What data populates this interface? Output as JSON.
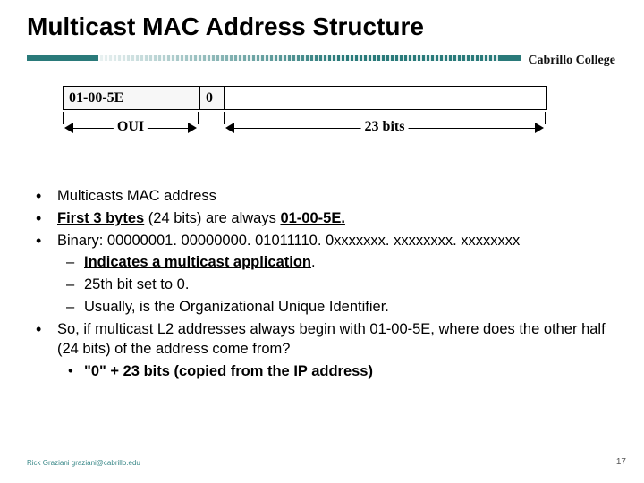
{
  "title": "Multicast MAC Address Structure",
  "brand": "Cabrillo College",
  "diagram": {
    "oui_cell": "01-00-5E",
    "zero_cell": "0",
    "oui_label": "OUI",
    "bits_label": "23 bits"
  },
  "bullets": {
    "b1": "Multicasts MAC address",
    "b2_prefix": "First 3 bytes",
    "b2_mid": " (24 bits) are always ",
    "b2_suffix": "01-00-5E.",
    "b3": "Binary: 00000001. 00000000. 01011110. 0xxxxxxx. xxxxxxxx. xxxxxxxx",
    "s1": "Indicates a multicast application",
    "s2": "25th bit set to 0.",
    "s3": "Usually, is the Organizational Unique Identifier.",
    "b4": "So, if multicast L2 addresses always begin with 01-00-5E, where does the other half (24 bits) of the address come from?",
    "s4": "\"0\" + 23 bits (copied from the IP address)"
  },
  "footer": {
    "author": "Rick Graziani  graziani@cabrillo.edu",
    "page": "17"
  }
}
